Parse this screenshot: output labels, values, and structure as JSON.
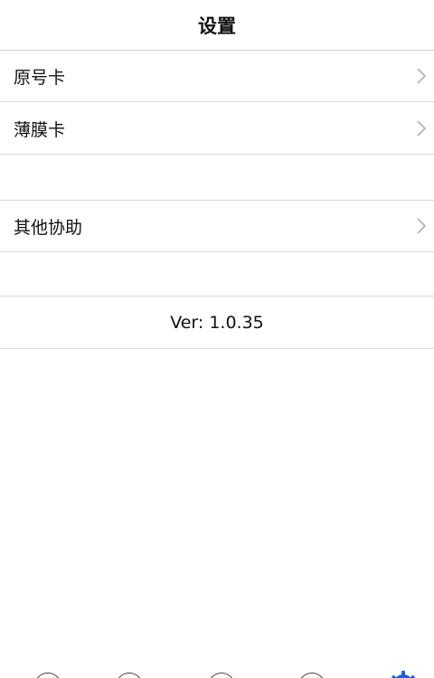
{
  "nav": {
    "title": "设置"
  },
  "rows": [
    {
      "label": "原号卡"
    },
    {
      "label": "薄膜卡"
    },
    {
      "label": "其他协助"
    }
  ],
  "version": {
    "text": "Ver: 1.0.35"
  },
  "tabbar": {
    "active_color": "#1f5fd6"
  }
}
